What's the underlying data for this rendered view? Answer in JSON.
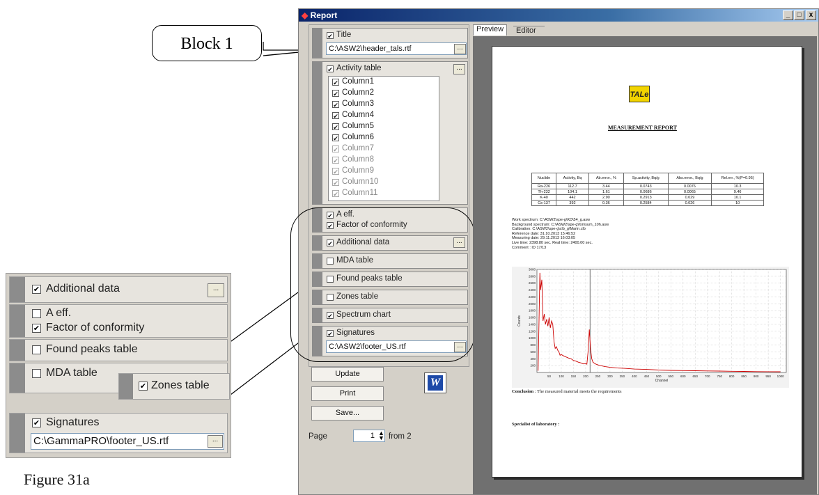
{
  "callout": {
    "label": "Block 1"
  },
  "figure_caption": "Figure 31a",
  "window": {
    "title": "Report",
    "btn_min": "_",
    "btn_max": "□",
    "btn_close": "x"
  },
  "tabs": [
    {
      "label": "Preview"
    },
    {
      "label": "Editor"
    }
  ],
  "blocks": {
    "title": {
      "label": "Title",
      "checked": true,
      "path": "C:\\ASW2\\header_tals.rtf"
    },
    "activity": {
      "label": "Activity table",
      "columns": [
        {
          "label": "Column1",
          "enabled": true
        },
        {
          "label": "Column2",
          "enabled": true
        },
        {
          "label": "Column3",
          "enabled": true
        },
        {
          "label": "Column4",
          "enabled": true
        },
        {
          "label": "Column5",
          "enabled": true
        },
        {
          "label": "Column6",
          "enabled": true
        },
        {
          "label": "Column7",
          "enabled": false
        },
        {
          "label": "Column8",
          "enabled": false
        },
        {
          "label": "Column9",
          "enabled": false
        },
        {
          "label": "Column10",
          "enabled": false
        },
        {
          "label": "Column11",
          "enabled": false
        }
      ]
    },
    "aeff": {
      "label": "A eff.",
      "checked": true
    },
    "conformity": {
      "label": "Factor of conformity",
      "checked": true
    },
    "additional": {
      "label": "Additional data",
      "checked": true
    },
    "mda": {
      "label": "MDA table",
      "checked": false
    },
    "found_peaks": {
      "label": "Found peaks table",
      "checked": false
    },
    "zones": {
      "label": "Zones table",
      "checked": false
    },
    "spectrum": {
      "label": "Spectrum chart",
      "checked": true
    },
    "signatures": {
      "label": "Signatures",
      "checked": true,
      "path": "C:\\ASW2\\footer_US.rtf"
    }
  },
  "buttons": {
    "update": "Update",
    "print": "Print",
    "save": "Save...",
    "dots": "..."
  },
  "pager": {
    "label": "Page",
    "value": "1",
    "suffix": "from 2"
  },
  "inset": {
    "additional": "Additional data",
    "aeff": "A eff.",
    "conformity": "Factor of conformity",
    "found_peaks": "Found peaks table",
    "mda": "MDA table",
    "zones": "Zones table",
    "signatures": "Signatures",
    "path": "C:\\GammaPRO\\footer_US.rtf"
  },
  "report": {
    "logo": "TALe",
    "heading": "MEASUREMENT REPORT",
    "table_headers": [
      "Nuclide",
      "Activity, Bq",
      "Ab.error., %",
      "Sp.activity, Bq/g",
      "Abs.error., Bq/g",
      "Rel.err., %(P=0.95)"
    ],
    "table_rows": [
      [
        "Ra-226",
        "112.7",
        "3.44",
        "0.0743",
        "0.0076",
        "10.3"
      ],
      [
        "Th-232",
        "104.1",
        "1.61",
        "0.0686",
        "0.0065",
        "9.46"
      ],
      [
        "K-40",
        "442",
        "2.90",
        "0.2913",
        "0.029",
        "10.1"
      ],
      [
        "Cs-137",
        "392",
        "0.36",
        "0.2584",
        "0.026",
        "10"
      ]
    ],
    "info": [
      "Work spectrum:   C:\\ASW2\\spe-g\\KD\\54_g.asw",
      "Background spectrum:   C:\\ASW2\\spe-g\\fon\\sum_10h.asw",
      "Calibration:   C:\\ASW2\\spe-g\\clb_g\\Marin.clb",
      "Reference date: 31.10.2013  15:46:52",
      "Measuring date: 29.11.2013  16:03:05",
      "Live time: 2398.80 sec.  Real time: 2400.00 sec.",
      "Comment :  ID 17/13"
    ],
    "conclusion_label": "Conclusion",
    "conclusion_text": ": The measured material meets the requirements",
    "specialist": "Specialist of laboratory :"
  },
  "chart_data": {
    "type": "line",
    "xlabel": "Channel",
    "ylabel": "Counts",
    "xlim": [
      0,
      1024
    ],
    "ylim": [
      0,
      3000
    ],
    "x_ticks": [
      50,
      100,
      150,
      200,
      250,
      300,
      350,
      400,
      450,
      500,
      550,
      600,
      650,
      700,
      750,
      800,
      850,
      900,
      950,
      1000
    ],
    "y_ticks": [
      200,
      400,
      600,
      800,
      1000,
      1200,
      1400,
      1600,
      1800,
      2000,
      2200,
      2400,
      2600,
      2800,
      3000
    ],
    "grid": true,
    "marker_x": 218,
    "series": [
      {
        "color": "#cc0000",
        "x": [
          5,
          12,
          15,
          20,
          25,
          30,
          35,
          40,
          45,
          50,
          55,
          60,
          65,
          70,
          75,
          80,
          85,
          90,
          95,
          100,
          110,
          120,
          130,
          140,
          150,
          160,
          170,
          180,
          190,
          200,
          205,
          210,
          215,
          220,
          225,
          230,
          240,
          250,
          260,
          280,
          300,
          330,
          360,
          400,
          450,
          500,
          550,
          600,
          650,
          700,
          750,
          800,
          850,
          900,
          950,
          1000
        ],
        "y": [
          50,
          2900,
          2400,
          2700,
          1500,
          1700,
          1400,
          1550,
          1350,
          1600,
          1300,
          1500,
          1400,
          900,
          700,
          750,
          650,
          600,
          500,
          520,
          480,
          450,
          420,
          400,
          350,
          330,
          300,
          280,
          250,
          260,
          240,
          600,
          1250,
          700,
          400,
          300,
          250,
          220,
          200,
          170,
          150,
          130,
          120,
          100,
          90,
          70,
          60,
          55,
          50,
          45,
          40,
          35,
          30,
          25,
          22,
          20
        ]
      }
    ]
  }
}
